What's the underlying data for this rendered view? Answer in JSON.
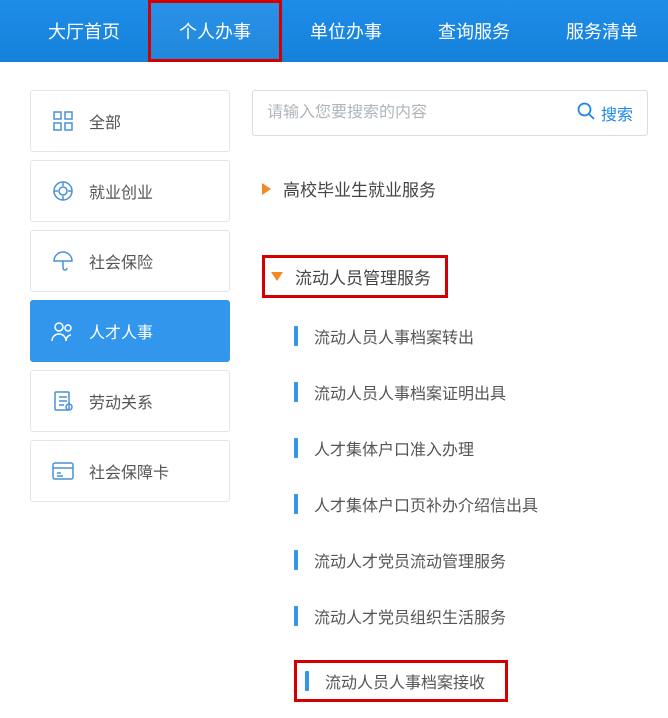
{
  "nav": {
    "items": [
      "大厅首页",
      "个人办事",
      "单位办事",
      "查询服务",
      "服务清单"
    ],
    "activeIndex": 1
  },
  "sidebar": {
    "items": [
      {
        "label": "全部",
        "icon": "grid-icon"
      },
      {
        "label": "就业创业",
        "icon": "target-icon"
      },
      {
        "label": "社会保险",
        "icon": "umbrella-icon"
      },
      {
        "label": "人才人事",
        "icon": "people-icon"
      },
      {
        "label": "劳动关系",
        "icon": "document-icon"
      },
      {
        "label": "社会保障卡",
        "icon": "card-icon"
      }
    ],
    "activeIndex": 3
  },
  "search": {
    "placeholder": "请输入您要搜索的内容",
    "button": "搜索"
  },
  "sections": [
    {
      "label": "高校毕业生就业服务",
      "expanded": false
    },
    {
      "label": "流动人员管理服务",
      "expanded": true,
      "highlighted": true,
      "items": [
        {
          "label": "流动人员人事档案转出"
        },
        {
          "label": "流动人员人事档案证明出具"
        },
        {
          "label": "人才集体户口准入办理"
        },
        {
          "label": "人才集体户口页补办介绍信出具"
        },
        {
          "label": "流动人才党员流动管理服务"
        },
        {
          "label": "流动人才党员组织生活服务"
        },
        {
          "label": "流动人员人事档案接收",
          "highlighted": true
        }
      ]
    }
  ]
}
